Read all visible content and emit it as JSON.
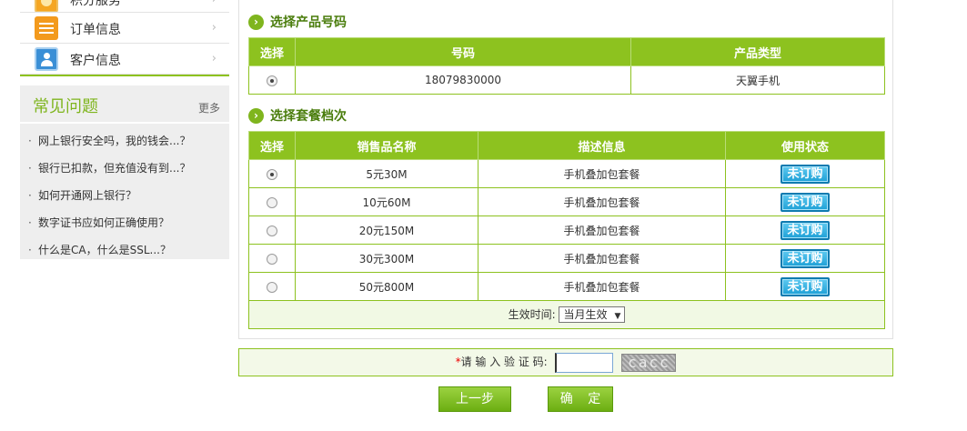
{
  "sidebar": {
    "menu": [
      {
        "label": "积分服务",
        "icon": "star-badge-icon"
      },
      {
        "label": "订单信息",
        "icon": "document-icon"
      },
      {
        "label": "客户信息",
        "icon": "user-card-icon"
      }
    ],
    "chevron": "›"
  },
  "faq": {
    "title": "常见问题",
    "more": "更多",
    "items": [
      "网上银行安全吗，我的钱会...？",
      "银行已扣款，但充值没有到...？",
      "如何开通网上银行？",
      "数字证书应如何正确使用？",
      "什么是CA，什么是SSL...？"
    ]
  },
  "product_section": {
    "title": "选择产品号码",
    "headers": [
      "选择",
      "号码",
      "产品类型"
    ],
    "rows": [
      {
        "selected": true,
        "number": "18079830000",
        "type": "天翼手机"
      }
    ]
  },
  "package_section": {
    "title": "选择套餐档次",
    "headers": [
      "选择",
      "销售品名称",
      "描述信息",
      "使用状态"
    ],
    "rows": [
      {
        "selected": true,
        "name": "5元30M",
        "desc": "手机叠加包套餐",
        "status": "未订购"
      },
      {
        "selected": false,
        "name": "10元60M",
        "desc": "手机叠加包套餐",
        "status": "未订购"
      },
      {
        "selected": false,
        "name": "20元150M",
        "desc": "手机叠加包套餐",
        "status": "未订购"
      },
      {
        "selected": false,
        "name": "30元300M",
        "desc": "手机叠加包套餐",
        "status": "未订购"
      },
      {
        "selected": false,
        "name": "50元800M",
        "desc": "手机叠加包套餐",
        "status": "未订购"
      }
    ],
    "effective_label": "生效时间:",
    "effective_value": "当月生效"
  },
  "captcha": {
    "required_mark": "*",
    "label": "请 输 入 验 证 码:",
    "value": "",
    "image_text": "cacc"
  },
  "buttons": {
    "prev": "上一步",
    "confirm": "确 定"
  },
  "colors": {
    "brand_green": "#8dc21f",
    "title_green": "#7fb51e",
    "status_blue": "#1ea0d6"
  }
}
